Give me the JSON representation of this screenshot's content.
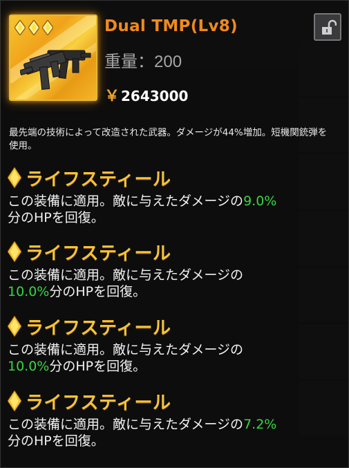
{
  "item": {
    "name": "Dual TMP(Lv8)",
    "rarity_stars": 3,
    "weight_label": "重量：200",
    "price_symbol": "￥",
    "price": "2643000",
    "locked": false
  },
  "description": "最先端の技術によって改造された武器。ダメージが44%増加。短機関銃弾を使用。",
  "skills": [
    {
      "name": "ライフスティール",
      "pre": "この装備に適用。敵に与えたダメージの",
      "value": "9.0%",
      "post": "分のHPを回復。"
    },
    {
      "name": "ライフスティール",
      "pre": "この装備に適用。敵に与えたダメージの",
      "value": "10.0%",
      "post": "分のHPを回復。"
    },
    {
      "name": "ライフスティール",
      "pre": "この装備に適用。敵に与えたダメージの",
      "value": "10.0%",
      "post": "分のHPを回復。"
    },
    {
      "name": "ライフスティール",
      "pre": "この装備に適用。敵に与えたダメージの",
      "value": "7.2%",
      "post": "分のHPを回復。"
    }
  ],
  "colors": {
    "title": "#f08a1c",
    "skill_name": "#f5c33a",
    "value_green": "#38d645",
    "frame_gold": "#e8b830"
  },
  "icons": [
    "rarity-star-icon",
    "smg-weapon-icon",
    "padlock-open-icon",
    "skill-diamond-icon"
  ]
}
